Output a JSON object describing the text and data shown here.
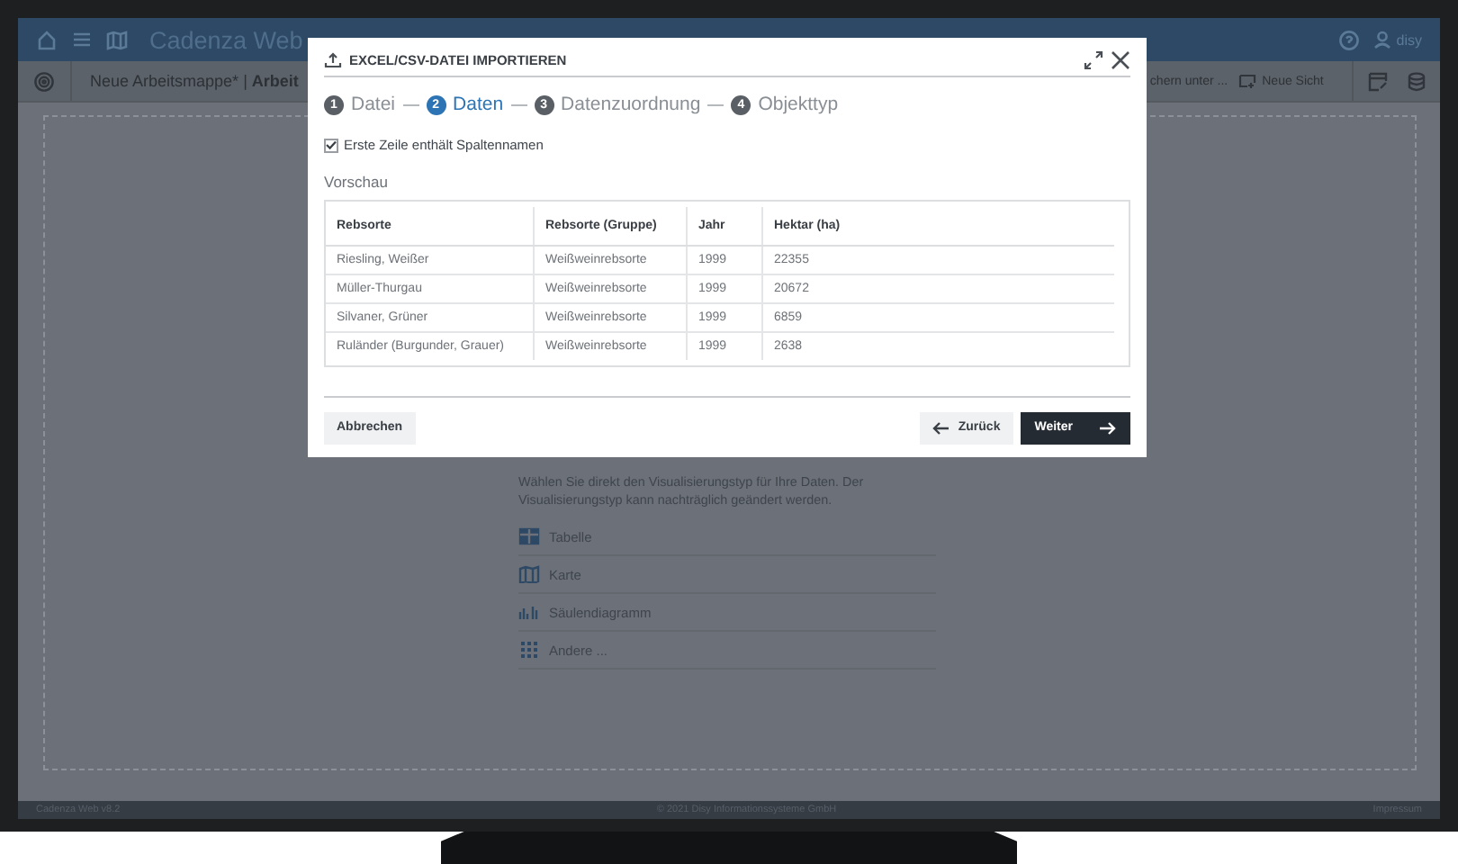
{
  "app": {
    "title": "Cadenza Web",
    "user": "disy"
  },
  "toolbar": {
    "workbook": "Neue Arbeitsmappe*",
    "separator": "|",
    "sheet": "Arbeit",
    "save_as": "chern unter ...",
    "new_view": "Neue Sicht"
  },
  "panel": {
    "description": "Wählen Sie direkt den Visualisierungstyp für Ihre Daten. Der Visualisierungstyp kann nachträglich geändert werden.",
    "options": [
      {
        "kind": "table",
        "label": "Tabelle"
      },
      {
        "kind": "map",
        "label": "Karte"
      },
      {
        "kind": "bars",
        "label": "Säulendiagramm"
      },
      {
        "kind": "grid",
        "label": "Andere ..."
      }
    ]
  },
  "dialog": {
    "title": "EXCEL/CSV-DATEI IMPORTIEREN",
    "steps": [
      {
        "number": "1",
        "label": "Datei",
        "selected": false
      },
      {
        "number": "2",
        "label": "Daten",
        "selected": true
      },
      {
        "number": "3",
        "label": "Datenzuordnung",
        "selected": false
      },
      {
        "number": "4",
        "label": "Objekttyp",
        "selected": false
      }
    ],
    "header_option": {
      "label": "Erste Zeile enthält Spaltennamen",
      "checked": true
    },
    "preview_label": "Vorschau",
    "table": {
      "columns": [
        "Rebsorte",
        "Rebsorte (Gruppe)",
        "Jahr",
        "Hektar (ha)"
      ],
      "rows": [
        [
          "Riesling, Weißer",
          "Weißweinrebsorte",
          "1999",
          "22355"
        ],
        [
          "Müller-Thurgau",
          "Weißweinrebsorte",
          "1999",
          "20672"
        ],
        [
          "Silvaner, Grüner",
          "Weißweinrebsorte",
          "1999",
          "6859"
        ],
        [
          "Ruländer (Burgunder, Grauer)",
          "Weißweinrebsorte",
          "1999",
          "2638"
        ]
      ]
    },
    "buttons": {
      "cancel": "Abbrechen",
      "back": "Zurück",
      "next": "Weiter"
    }
  },
  "footer": {
    "version": "Cadenza Web v8.2",
    "copyright": "© 2021 Disy Informationssysteme GmbH",
    "link": "Impressum"
  }
}
